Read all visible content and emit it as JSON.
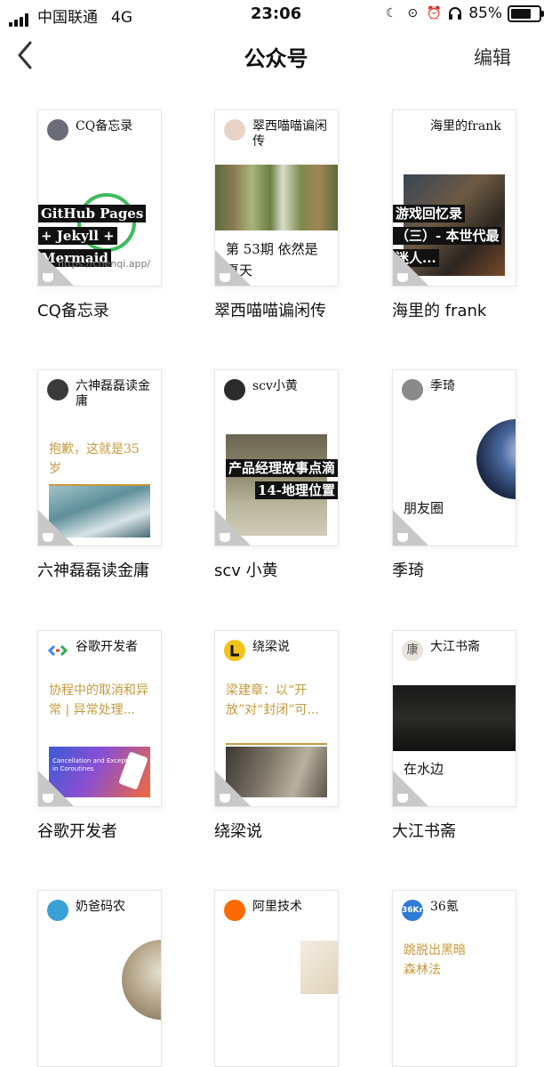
{
  "status_bar": {
    "carrier": "中国联通",
    "network": "4G",
    "time": "23:06",
    "battery_percent_text": "85%",
    "battery_level": 0.85,
    "icons": [
      "moon-icon",
      "rotation-lock-icon",
      "alarm-icon",
      "headphones-icon"
    ]
  },
  "nav": {
    "back_icon": "chevron-left-icon",
    "title": "公众号",
    "edit_label": "编辑"
  },
  "accounts": [
    {
      "name": "CQ备忘录",
      "card_account": "CQ备忘录",
      "card_text": "GitHub Pages + Jekyll + Mermaid",
      "card_url": "https://chenqi.app/"
    },
    {
      "name": "翠西喵喵谝闲传",
      "card_account": "翠西喵喵谝闲传",
      "card_text": "第 53期 依然是夏天"
    },
    {
      "name": "海里的 frank",
      "card_account": "海里的frank",
      "card_text": "游戏回忆录（三）- 本世代最迷人..."
    },
    {
      "name": "六神磊磊读金庸",
      "card_account": "六神磊磊读金庸",
      "card_text": "抱歉，这就是35岁"
    },
    {
      "name": "scv 小黄",
      "card_account": "scv小黄",
      "card_text": "产品经理故事点滴14-地理位置"
    },
    {
      "name": "季琦",
      "card_account": "季琦",
      "card_text": "朋友圈"
    },
    {
      "name": "谷歌开发者",
      "card_account": "谷歌开发者",
      "card_text": "协程中的取消和异常 | 异常处理...",
      "card_image_text": [
        "Cancellation and Exceptions",
        "in Coroutines"
      ]
    },
    {
      "name": "绕梁说",
      "card_account": "绕梁说",
      "card_text": "梁建章：以“开放”对“封闭”可..."
    },
    {
      "name": "大江书斋",
      "card_account": "大江书斋",
      "card_text": "在水边",
      "avatar_char": "康"
    },
    {
      "name": "奶爸码农",
      "card_account": "奶爸码农",
      "card_text": ""
    },
    {
      "name": "阿里技术",
      "card_account": "阿里技术",
      "card_text": ""
    },
    {
      "name": "36氪",
      "card_account": "36氪",
      "card_text": "跳脱出黑暗森林法",
      "avatar_char": "36Kr"
    }
  ]
}
